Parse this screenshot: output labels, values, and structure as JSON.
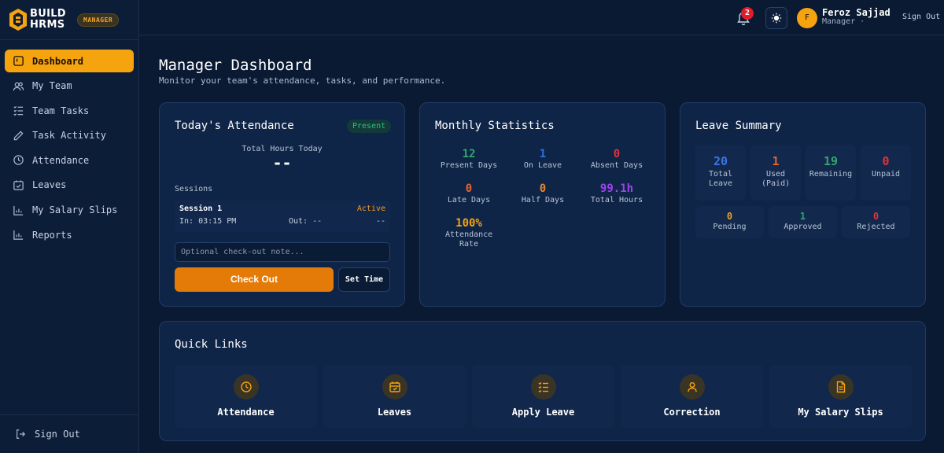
{
  "brand": {
    "name_line1": "BUILD",
    "name_line2": "HRMS",
    "role_badge": "MANAGER"
  },
  "sidebar": {
    "items": [
      {
        "label": "Dashboard",
        "icon": "dashboard-icon",
        "active": true
      },
      {
        "label": "My Team",
        "icon": "users-icon"
      },
      {
        "label": "Team Tasks",
        "icon": "checklist-icon"
      },
      {
        "label": "Task Activity",
        "icon": "pencil-icon"
      },
      {
        "label": "Attendance",
        "icon": "clock-icon"
      },
      {
        "label": "Leaves",
        "icon": "calendar-check-icon"
      },
      {
        "label": "My Salary Slips",
        "icon": "bar-chart-icon"
      },
      {
        "label": "Reports",
        "icon": "bar-chart-icon"
      }
    ],
    "sign_out": "Sign Out"
  },
  "header": {
    "notification_count": "2",
    "user_initial": "F",
    "user_name": "Feroz Sajjad",
    "user_role": "Manager ·",
    "sign_out": "Sign Out"
  },
  "page": {
    "title": "Manager Dashboard",
    "subtitle": "Monitor your team's attendance, tasks, and performance."
  },
  "attendance": {
    "title": "Today's Attendance",
    "status": "Present",
    "total_label": "Total Hours Today",
    "total_value": "--",
    "sessions_label": "Sessions",
    "session": {
      "name": "Session 1",
      "status": "Active",
      "in": "In: 03:15 PM",
      "out": "Out: --",
      "duration": "--"
    },
    "note_placeholder": "Optional check-out note...",
    "checkout_label": "Check Out",
    "settime_label": "Set Time"
  },
  "monthly": {
    "title": "Monthly Statistics",
    "stats": [
      {
        "value": "12",
        "label": "Present Days",
        "color": "#2ea86b"
      },
      {
        "value": "1",
        "label": "On Leave",
        "color": "#2f6fe4"
      },
      {
        "value": "0",
        "label": "Absent Days",
        "color": "#e0323a"
      },
      {
        "value": "0",
        "label": "Late Days",
        "color": "#e8622a"
      },
      {
        "value": "0",
        "label": "Half Days",
        "color": "#e8862a"
      },
      {
        "value": "99.1h",
        "label": "Total Hours",
        "color": "#9b45e8"
      },
      {
        "value": "100%",
        "label": "Attendance Rate",
        "color": "#f5a30f"
      }
    ]
  },
  "leave": {
    "title": "Leave Summary",
    "boxes": [
      {
        "value": "20",
        "label": "Total Leave",
        "color": "#3b74e6"
      },
      {
        "value": "1",
        "label": "Used (Paid)",
        "color": "#e8622a"
      },
      {
        "value": "19",
        "label": "Remaining",
        "color": "#2ea86b"
      },
      {
        "value": "0",
        "label": "Unpaid",
        "color": "#e0323a"
      }
    ],
    "small": [
      {
        "value": "0",
        "label": "Pending",
        "color": "#e8a02a"
      },
      {
        "value": "1",
        "label": "Approved",
        "color": "#2ea86b"
      },
      {
        "value": "0",
        "label": "Rejected",
        "color": "#e0323a"
      }
    ]
  },
  "quick_links": {
    "title": "Quick Links",
    "items": [
      {
        "label": "Attendance",
        "icon": "clock-icon"
      },
      {
        "label": "Leaves",
        "icon": "calendar-icon"
      },
      {
        "label": "Apply Leave",
        "icon": "checklist-icon"
      },
      {
        "label": "Correction",
        "icon": "user-icon"
      },
      {
        "label": "My Salary Slips",
        "icon": "document-icon"
      }
    ]
  }
}
